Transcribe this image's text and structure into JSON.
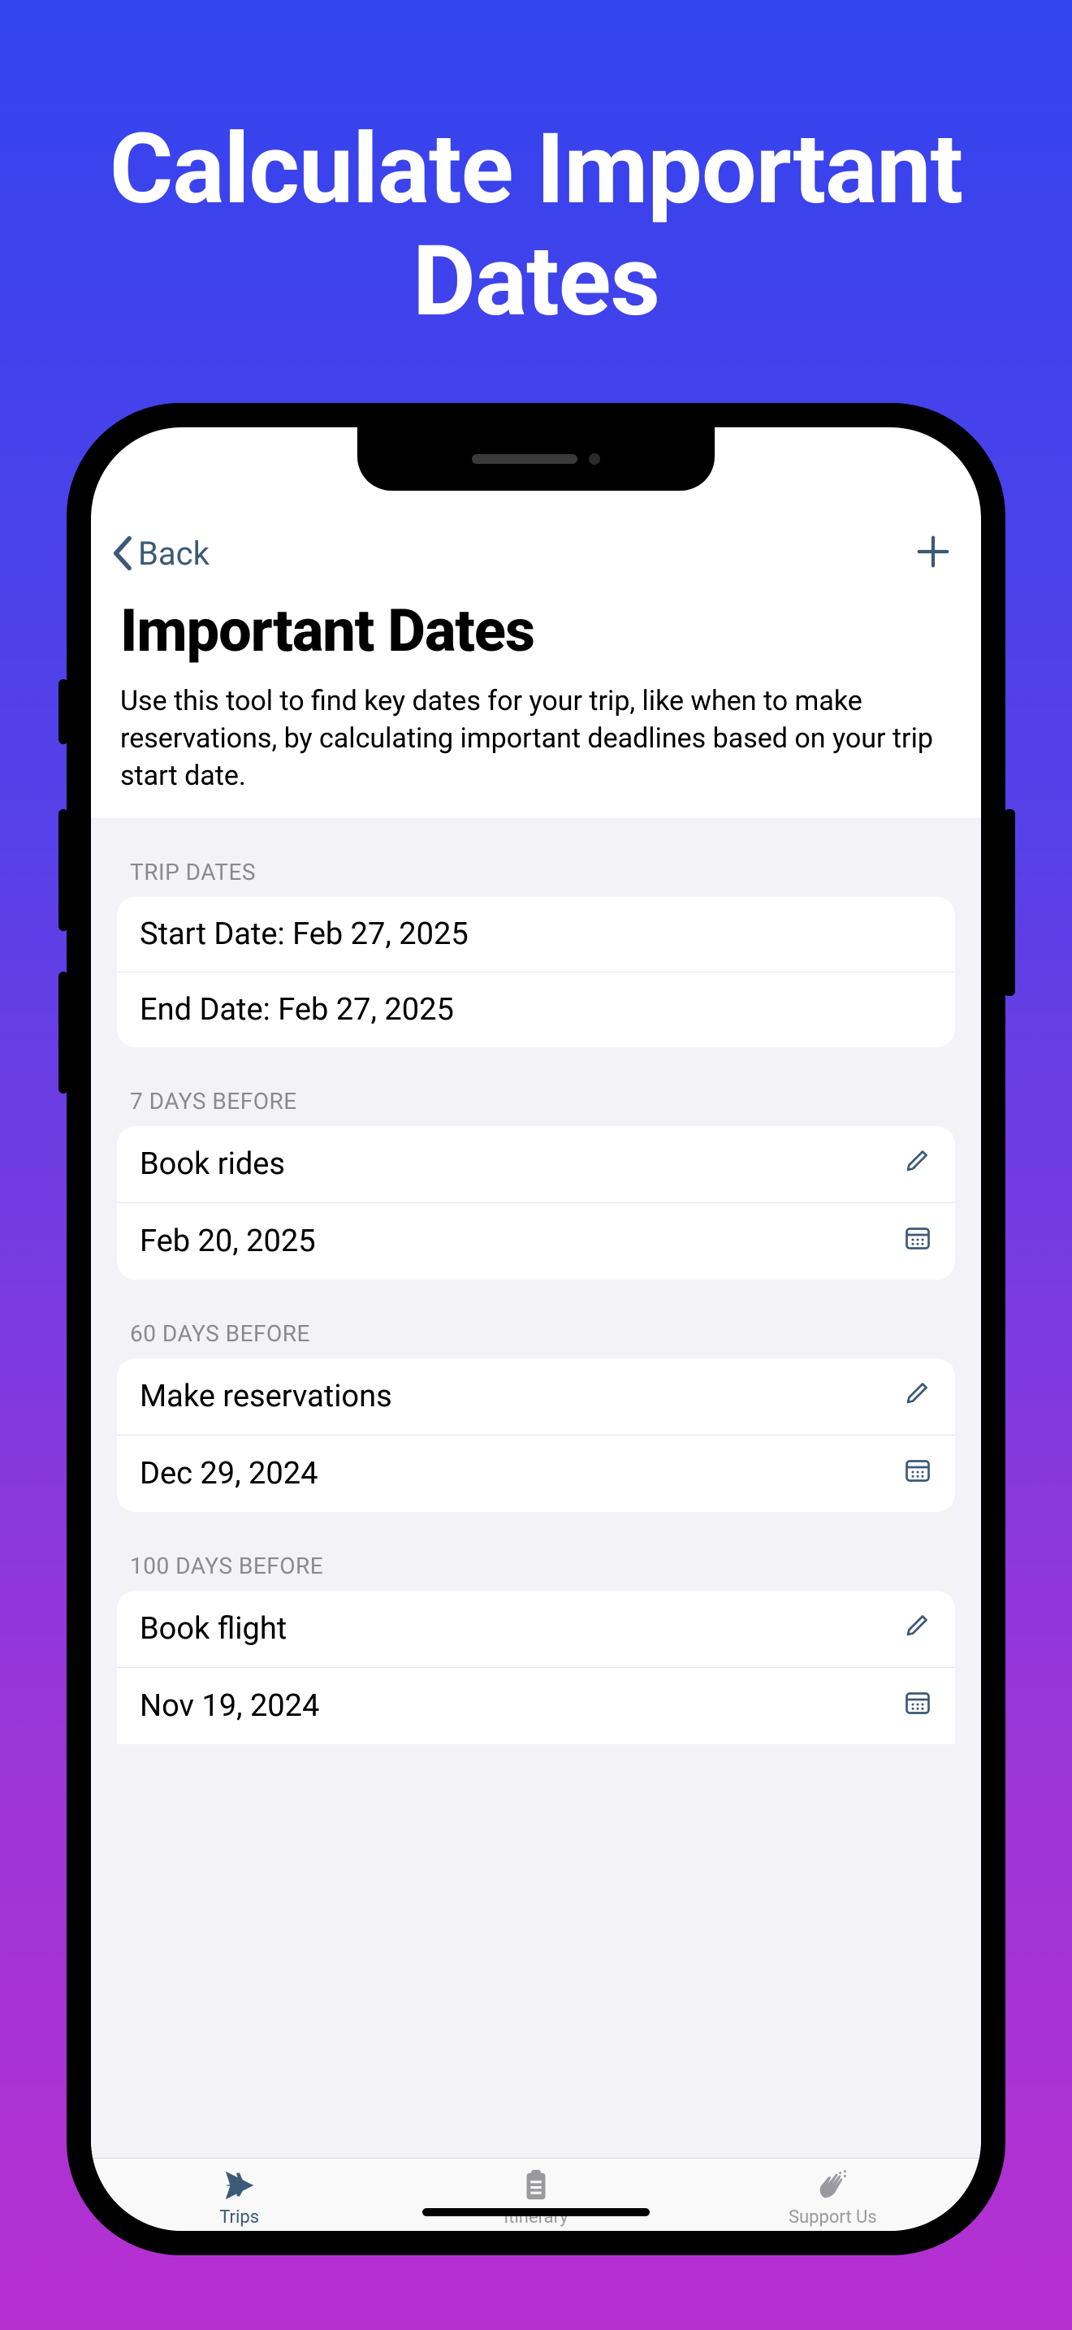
{
  "promo": {
    "title": "Calculate Important Dates"
  },
  "nav": {
    "back_label": "Back"
  },
  "header": {
    "title": "Important Dates",
    "subtitle": "Use this tool to find key dates for your trip, like when to make reservations, by calculating important deadlines based on your trip start date."
  },
  "trip_dates": {
    "section_label": "TRIP DATES",
    "start_row": "Start Date: Feb 27, 2025",
    "end_row": "End Date: Feb 27, 2025"
  },
  "items": [
    {
      "section_label": "7 DAYS BEFORE",
      "task": "Book rides",
      "date": "Feb 20, 2025"
    },
    {
      "section_label": "60 DAYS BEFORE",
      "task": "Make reservations",
      "date": "Dec 29, 2024"
    },
    {
      "section_label": "100 DAYS BEFORE",
      "task": "Book flight",
      "date": "Nov 19, 2024"
    }
  ],
  "tabs": {
    "trips": "Trips",
    "itinerary": "Itinerary",
    "support": "Support Us"
  }
}
